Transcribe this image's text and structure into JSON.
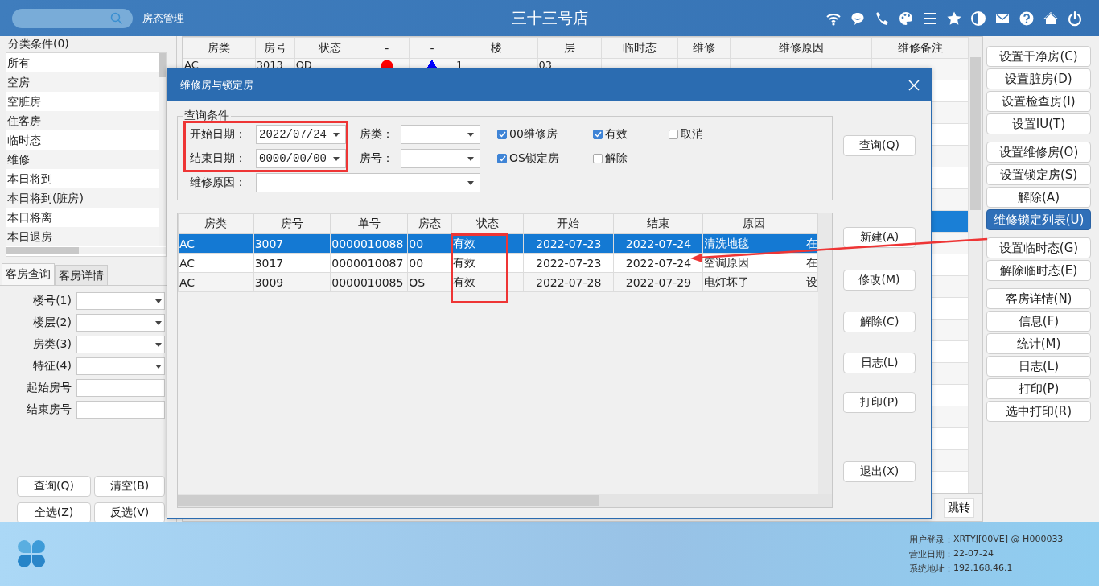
{
  "topbar": {
    "module": "房态管理",
    "title": "三十三号店"
  },
  "category_panel": {
    "title": "分类条件(0)",
    "items": [
      {
        "label": "所有",
        "selected": false
      },
      {
        "label": "空房",
        "selected": false
      },
      {
        "label": "空脏房",
        "selected": false
      },
      {
        "label": "住客房",
        "selected": false
      },
      {
        "label": "临时态",
        "selected": false
      },
      {
        "label": "维修",
        "selected": false
      },
      {
        "label": "本日将到",
        "selected": false
      },
      {
        "label": "本日将到(脏房)",
        "selected": false
      },
      {
        "label": "本日将离",
        "selected": false
      },
      {
        "label": "本日退房",
        "selected": false
      }
    ]
  },
  "query_tabs": [
    {
      "label": "客房查询",
      "selected": true
    },
    {
      "label": "客房详情",
      "selected": false
    }
  ],
  "query_fields": [
    {
      "label": "楼号(1)",
      "kind": "dropdown"
    },
    {
      "label": "楼层(2)",
      "kind": "dropdown"
    },
    {
      "label": "房类(3)",
      "kind": "dropdown"
    },
    {
      "label": "特征(4)",
      "kind": "dropdown"
    },
    {
      "label": "起始房号",
      "kind": "text"
    },
    {
      "label": "结束房号",
      "kind": "text"
    }
  ],
  "query_buttons": [
    "查询(Q)",
    "清空(B)",
    "全选(Z)",
    "反选(V)"
  ],
  "room_grid": {
    "columns": [
      "房类",
      "房号",
      "状态",
      "-",
      "-",
      "楼",
      "层",
      "临时态",
      "维修",
      "维修原因",
      "维修备注"
    ],
    "rows": [
      {
        "selected": false,
        "room_type": "AC",
        "room_no": "3013",
        "status": "OD",
        "icons": [
          {
            "kind": "dot",
            "color": "#ff0000"
          },
          {
            "kind": "triangle",
            "color": "#0000ff"
          }
        ],
        "building": "1",
        "floor": "03"
      },
      {
        "selected": false
      },
      {
        "selected": false
      },
      {
        "selected": false
      },
      {
        "selected": false
      },
      {
        "selected": false
      },
      {
        "selected": false
      },
      {
        "selected": true
      },
      {
        "selected": false
      },
      {
        "selected": false
      },
      {
        "selected": false
      },
      {
        "selected": false
      },
      {
        "selected": false
      },
      {
        "selected": false
      },
      {
        "selected": false
      },
      {
        "selected": false
      },
      {
        "selected": false
      },
      {
        "selected": false
      },
      {
        "selected": false
      },
      {
        "selected": false
      }
    ],
    "jump_button": "跳转"
  },
  "action_buttons": [
    [
      {
        "label": "设置干净房(C)",
        "selected": false
      },
      {
        "label": "设置脏房(D)",
        "selected": false
      },
      {
        "label": "设置检查房(I)",
        "selected": false
      },
      {
        "label": "设置IU(T)",
        "selected": false
      }
    ],
    [
      {
        "label": "设置维修房(O)",
        "selected": false
      },
      {
        "label": "设置锁定房(S)",
        "selected": false
      },
      {
        "label": "解除(A)",
        "selected": false
      },
      {
        "label": "维修锁定列表(U)",
        "selected": true
      }
    ],
    [
      {
        "label": "设置临时态(G)",
        "selected": false
      },
      {
        "label": "解除临时态(E)",
        "selected": false
      }
    ],
    [
      {
        "label": "客房详情(N)",
        "selected": false
      },
      {
        "label": "信息(F)",
        "selected": false
      },
      {
        "label": "统计(M)",
        "selected": false
      },
      {
        "label": "日志(L)",
        "selected": false
      },
      {
        "label": "打印(P)",
        "selected": false
      },
      {
        "label": "选中打印(R)",
        "selected": false
      }
    ]
  ],
  "dialog": {
    "title": "维修房与锁定房",
    "criteria": {
      "legend": "查询条件",
      "start_date": {
        "label": "开始日期：",
        "value": "2022/07/24"
      },
      "end_date": {
        "label": "结束日期：",
        "value": "0000/00/00"
      },
      "room_type": {
        "label": "房类："
      },
      "room_no": {
        "label": "房号："
      },
      "reason": {
        "label": "维修原因："
      },
      "checkboxes": [
        [
          {
            "label": "00维修房",
            "checked": true
          },
          {
            "label": "有效",
            "checked": true
          },
          {
            "label": "取消",
            "checked": false
          }
        ],
        [
          {
            "label": "OS锁定房",
            "checked": true
          },
          {
            "label": "解除",
            "checked": false
          }
        ]
      ]
    },
    "table": {
      "columns": [
        "房类",
        "房号",
        "单号",
        "房态",
        "状态",
        "开始",
        "结束",
        "原因"
      ],
      "rows": [
        {
          "selected": true,
          "cells": [
            "AC",
            "3007",
            "0000010088",
            "00",
            "有效",
            "2022-07-23",
            "2022-07-24",
            "清洗地毯",
            "在"
          ]
        },
        {
          "selected": false,
          "cells": [
            "AC",
            "3017",
            "0000010087",
            "00",
            "有效",
            "2022-07-23",
            "2022-07-24",
            "空调原因",
            "在"
          ]
        },
        {
          "selected": false,
          "cells": [
            "AC",
            "3009",
            "0000010085",
            "OS",
            "有效",
            "2022-07-28",
            "2022-07-29",
            "电灯坏了",
            "设"
          ]
        }
      ]
    },
    "buttons": [
      "查询(Q)",
      "新建(A)",
      "修改(M)",
      "解除(C)",
      "日志(L)",
      "打印(P)",
      "退出(X)"
    ]
  },
  "status": [
    {
      "label": "用户登录：",
      "value": "XRTYJ[00VE] @ H000033"
    },
    {
      "label": "营业日期：",
      "value": "22-07-24"
    },
    {
      "label": "系统地址：",
      "value": "192.168.46.1"
    }
  ]
}
